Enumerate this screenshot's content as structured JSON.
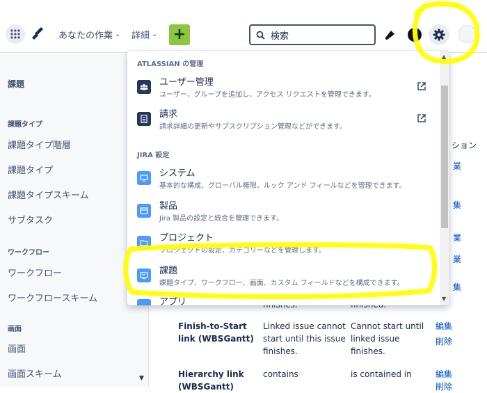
{
  "topnav": {
    "your_work": "あなたの作業",
    "more": "詳細",
    "create": "+",
    "search_placeholder": "検索"
  },
  "sidebar": {
    "main_title": "課題",
    "sections": [
      {
        "title": "課題タイプ",
        "items": [
          "課題タイプ階層",
          "課題タイプ",
          "課題タイプスキーム",
          "サブタスク"
        ]
      },
      {
        "title": "ワークフロー",
        "items": [
          "ワークフロー",
          "ワークフロースキーム"
        ]
      },
      {
        "title": "画面",
        "items": [
          "画面",
          "画面スキーム"
        ]
      }
    ]
  },
  "main": {
    "header_fragment": "ション",
    "links_fragment": [
      "業",
      "集",
      "業",
      "業",
      "集",
      "業",
      "集"
    ],
    "row_prev": {
      "col2": "finishes.",
      "col3": "finished."
    },
    "rows": [
      {
        "name": "Finish-to-Start link (WBSGantt)",
        "outward": "Linked issue cannot start until this issue finishes.",
        "inward": "Cannot start until linked issue finishes.",
        "edit": "編集",
        "delete": "削除"
      },
      {
        "name": "Hierarchy link (WBSGantt)",
        "outward": "contains",
        "inward": "is contained in",
        "edit": "編集",
        "delete": "削除"
      }
    ]
  },
  "menu": {
    "atlassian_heading": "ATLASSIAN の管理",
    "jira_heading": "JIRA 設定",
    "items": [
      {
        "title": "ユーザー管理",
        "desc": "ユーザー、グループを追加し、アクセス リクエストを管理できます。"
      },
      {
        "title": "請求",
        "desc": "請求詳細の更新やサブスクリプション管理などができます。"
      },
      {
        "title": "システム",
        "desc": "基本的な構成、グローバル権限、ルック アンド フィールなどを管理できます。"
      },
      {
        "title": "製品",
        "desc": "Jira 製品の設定と統合を管理できます。"
      },
      {
        "title": "プロジェクト",
        "desc": "プロジェクトの設定、カテゴリーなどを管理します。"
      },
      {
        "title": "課題",
        "desc": "課題タイプ、ワークフロー、画面、カスタム フィールドなどを構成できます。"
      },
      {
        "title": "アプリ",
        "desc": ""
      }
    ]
  },
  "colors": {
    "accent": "#0052cc",
    "create": "#8ec641",
    "highlight": "#ffff00"
  }
}
